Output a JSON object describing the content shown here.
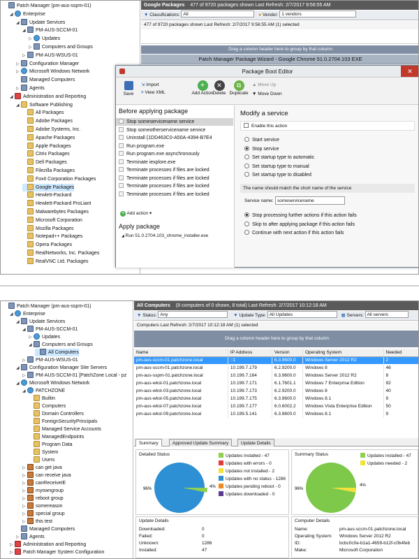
{
  "top": {
    "tree": [
      {
        "label": "Patch Manager (pm-aus-sspm-01)",
        "icon": "server",
        "indent": 0,
        "exp": "",
        "sel": false
      },
      {
        "label": "Enterprise",
        "icon": "globe",
        "indent": 1,
        "exp": "◢",
        "sel": false
      },
      {
        "label": "Update Services",
        "icon": "server",
        "indent": 2,
        "exp": "◢",
        "sel": false
      },
      {
        "label": "PM-AUS-SCCM-01",
        "icon": "server",
        "indent": 3,
        "exp": "◢",
        "sel": false
      },
      {
        "label": "Updates",
        "icon": "globe",
        "indent": 4,
        "exp": "▷",
        "sel": false
      },
      {
        "label": "Computers and Groups",
        "icon": "server",
        "indent": 4,
        "exp": "▷",
        "sel": false
      },
      {
        "label": "PM-AUS-WSUS-01",
        "icon": "server",
        "indent": 3,
        "exp": "▷",
        "sel": false
      },
      {
        "label": "Configuration Manager",
        "icon": "server",
        "indent": 2,
        "exp": "▷",
        "sel": false
      },
      {
        "label": "Microsoft Windows Network",
        "icon": "globe",
        "indent": 2,
        "exp": "▷",
        "sel": false
      },
      {
        "label": "Managed Computers",
        "icon": "server",
        "indent": 2,
        "exp": "",
        "sel": false
      },
      {
        "label": "Agents",
        "icon": "server",
        "indent": 2,
        "exp": "▷",
        "sel": false
      },
      {
        "label": "Administration and Reporting",
        "icon": "gear",
        "indent": 1,
        "exp": "◢",
        "sel": false
      },
      {
        "label": "Software Publishing",
        "icon": "folder",
        "indent": 2,
        "exp": "◢",
        "sel": false
      },
      {
        "label": "All Packages",
        "icon": "folder",
        "indent": 3,
        "exp": "",
        "sel": false
      },
      {
        "label": "Adobe Packages",
        "icon": "folder",
        "indent": 3,
        "exp": "",
        "sel": false
      },
      {
        "label": "Adobe Systems, Inc.",
        "icon": "folder",
        "indent": 3,
        "exp": "",
        "sel": false
      },
      {
        "label": "Apache Packages",
        "icon": "folder",
        "indent": 3,
        "exp": "",
        "sel": false
      },
      {
        "label": "Apple Packages",
        "icon": "folder",
        "indent": 3,
        "exp": "",
        "sel": false
      },
      {
        "label": "Citrix Packages",
        "icon": "folder",
        "indent": 3,
        "exp": "",
        "sel": false
      },
      {
        "label": "Dell Packages",
        "icon": "folder",
        "indent": 3,
        "exp": "",
        "sel": false
      },
      {
        "label": "Filezilla Packages",
        "icon": "folder",
        "indent": 3,
        "exp": "",
        "sel": false
      },
      {
        "label": "Foxit Corporation Packages",
        "icon": "folder",
        "indent": 3,
        "exp": "",
        "sel": false
      },
      {
        "label": "Google Packages",
        "icon": "folder",
        "indent": 3,
        "exp": "",
        "sel": true
      },
      {
        "label": "Hewlett-Packard",
        "icon": "folder",
        "indent": 3,
        "exp": "",
        "sel": false
      },
      {
        "label": "Hewlett-Packard ProLiant",
        "icon": "folder",
        "indent": 3,
        "exp": "",
        "sel": false
      },
      {
        "label": "Malwarebytes Packages",
        "icon": "folder",
        "indent": 3,
        "exp": "",
        "sel": false
      },
      {
        "label": "Microsoft Corporation",
        "icon": "folder",
        "indent": 3,
        "exp": "",
        "sel": false
      },
      {
        "label": "Mozilla Packages",
        "icon": "folder",
        "indent": 3,
        "exp": "",
        "sel": false
      },
      {
        "label": "Notepad++ Packages",
        "icon": "folder",
        "indent": 3,
        "exp": "",
        "sel": false
      },
      {
        "label": "Opera Packages",
        "icon": "folder",
        "indent": 3,
        "exp": "",
        "sel": false
      },
      {
        "label": "RealNetworks, Inc. Packages",
        "icon": "folder",
        "indent": 3,
        "exp": "",
        "sel": false
      },
      {
        "label": "RealVNC Ltd. Packages",
        "icon": "folder",
        "indent": 3,
        "exp": "",
        "sel": false
      }
    ],
    "header_title": "Google Packages",
    "header_status": "477 of 9720 packages shown  Last Refresh: 2/7/2017 9:56:55 AM",
    "header_count": "1 vendors",
    "classifications_label": "Classifications:",
    "classifications_value": "All",
    "vendor_label": "Vendor:",
    "vendor_value": "1 vendors",
    "grid_status": "477 of 9720 packages shown     Last Refresh: 2/7/2017 9:56:55 AM  (1) selected",
    "drag_text": "Drag a column header here to group by that column",
    "wizard_title": "Patch Manager Package Wizard - Google Chrome 51.0.2704.103 EXE",
    "editor": {
      "title": "Package Boot Editor",
      "toolbar": {
        "save": "Save",
        "import": "Import",
        "view_xml": "View XML",
        "add_action": "Add Action",
        "delete": "Delete",
        "duplicate": "Duplicate",
        "move_up": "Move Up",
        "move_down": "Move Down"
      },
      "before_heading": "Before applying package",
      "before_items": [
        "Stop someservicename service",
        "Stop someotherservicename service",
        "Uninstall {1DD463C0-A50A-4394-B7E4",
        "Run program.exe",
        "Run program.exe asynchronously",
        "Terminate iexplore.exe",
        "Terminate processes if files are locked",
        "Terminate processes if files are locked",
        "Terminate processes if files are locked",
        "Terminate processes if files are locked"
      ],
      "add_action_link": "Add action",
      "apply_heading": "Apply package",
      "apply_item": "Run 51.0.2704.103_chrome_installer.exe",
      "modify_heading": "Modify a service",
      "enable_label": "Enable this action",
      "service_options": [
        "Start service",
        "Stop service",
        "Set startup type to automatic",
        "Set startup type to manual",
        "Set startup type to disabled"
      ],
      "service_selected": 1,
      "hint": "The name should match the short name of the service",
      "service_name_label": "Service name:",
      "service_name_value": "someservicename",
      "failure_options": [
        "Stop processing further actions if this action fails",
        "Skip to after applying package if this action fails",
        "Continue with next action if this action fails"
      ],
      "failure_selected": 0
    }
  },
  "bottom": {
    "tree": [
      {
        "label": "Patch Manager (pm-aus-sspm-01)",
        "icon": "server",
        "indent": 0,
        "exp": "",
        "sel": false
      },
      {
        "label": "Enterprise",
        "icon": "globe",
        "indent": 1,
        "exp": "◢",
        "sel": false
      },
      {
        "label": "Update Services",
        "icon": "server",
        "indent": 2,
        "exp": "◢",
        "sel": false
      },
      {
        "label": "PM-AUS-SCCM-01",
        "icon": "server",
        "indent": 3,
        "exp": "◢",
        "sel": false
      },
      {
        "label": "Updates",
        "icon": "globe",
        "indent": 4,
        "exp": "▷",
        "sel": false
      },
      {
        "label": "Computers and Groups",
        "icon": "server",
        "indent": 4,
        "exp": "◢",
        "sel": false
      },
      {
        "label": "All Computers",
        "icon": "server",
        "indent": 5,
        "exp": "",
        "sel": true
      },
      {
        "label": "PM-AUS-WSUS-01",
        "icon": "server",
        "indent": 3,
        "exp": "▷",
        "sel": false
      },
      {
        "label": "Configuration Manager Site Servers",
        "icon": "server",
        "indent": 2,
        "exp": "◢",
        "sel": false
      },
      {
        "label": "PM-AUS-SCCM-01 [PatchZone Local - pz",
        "icon": "server",
        "indent": 3,
        "exp": "▷",
        "sel": false
      },
      {
        "label": "Microsoft Windows Network",
        "icon": "globe",
        "indent": 2,
        "exp": "◢",
        "sel": false
      },
      {
        "label": "PATCHZONE",
        "icon": "globe",
        "indent": 3,
        "exp": "◢",
        "sel": false
      },
      {
        "label": "Builtin",
        "icon": "folder",
        "indent": 4,
        "exp": "",
        "sel": false
      },
      {
        "label": "Computers",
        "icon": "folder",
        "indent": 4,
        "exp": "",
        "sel": false
      },
      {
        "label": "Domain Controllers",
        "icon": "folder",
        "indent": 4,
        "exp": "",
        "sel": false
      },
      {
        "label": "ForeignSecurityPrincipals",
        "icon": "folder",
        "indent": 4,
        "exp": "",
        "sel": false
      },
      {
        "label": "Managed Service Accounts",
        "icon": "folder",
        "indent": 4,
        "exp": "",
        "sel": false
      },
      {
        "label": "ManagedEndpoints",
        "icon": "folder",
        "indent": 4,
        "exp": "",
        "sel": false
      },
      {
        "label": "Program Data",
        "icon": "folder",
        "indent": 4,
        "exp": "",
        "sel": false
      },
      {
        "label": "System",
        "icon": "folder",
        "indent": 4,
        "exp": "",
        "sel": false
      },
      {
        "label": "Users",
        "icon": "folder",
        "indent": 4,
        "exp": "",
        "sel": false
      },
      {
        "label": "can get java",
        "icon": "pkg",
        "indent": 3,
        "exp": "▷",
        "sel": false
      },
      {
        "label": "can receive java",
        "icon": "pkg",
        "indent": 3,
        "exp": "▷",
        "sel": false
      },
      {
        "label": "canReceiveIE",
        "icon": "pkg",
        "indent": 3,
        "exp": "▷",
        "sel": false
      },
      {
        "label": "myowngroup",
        "icon": "pkg",
        "indent": 3,
        "exp": "▷",
        "sel": false
      },
      {
        "label": "reboot group",
        "icon": "pkg",
        "indent": 3,
        "exp": "▷",
        "sel": false
      },
      {
        "label": "somereason",
        "icon": "pkg",
        "indent": 3,
        "exp": "▷",
        "sel": false
      },
      {
        "label": "special group",
        "icon": "pkg",
        "indent": 3,
        "exp": "▷",
        "sel": false
      },
      {
        "label": "this test",
        "icon": "pkg",
        "indent": 3,
        "exp": "▷",
        "sel": false
      },
      {
        "label": "Managed Computers",
        "icon": "server",
        "indent": 2,
        "exp": "",
        "sel": false
      },
      {
        "label": "Agents",
        "icon": "server",
        "indent": 2,
        "exp": "▷",
        "sel": false
      },
      {
        "label": "Administration and Reporting",
        "icon": "gear",
        "indent": 1,
        "exp": "▷",
        "sel": false
      },
      {
        "label": "Patch Manager System Configuration",
        "icon": "gear",
        "indent": 1,
        "exp": "▷",
        "sel": false
      }
    ],
    "header_title": "All Computers",
    "header_status": "(8 computers of 0 shown, 8 total) Last Refresh: 2/7/2017 10:12:18 AM",
    "status_label": "Status:",
    "status_value": "Any",
    "update_type_label": "Update Type:",
    "update_type_value": "All Updates",
    "servers_label": "Servers:",
    "servers_value": "All servers",
    "grid_status": "Computers Last Refresh: 2/7/2017 10:12:18 AM  (1) selected",
    "drag_text": "Drag a column header here to group by that column",
    "columns": [
      "Name",
      "IP Address",
      "Version",
      "Operating System",
      "Needed"
    ],
    "rows": [
      [
        "pm-aus-sccm-01.patchzone.local",
        "::1",
        "6.3.9600.0",
        "Windows Server 2012 R2",
        "2"
      ],
      [
        "pm-aus-sccm-01.patchzone.local",
        "10.199.7.179",
        "6.2.9200.0",
        "Windows 8",
        "46"
      ],
      [
        "pm-aus-sspm-01.patchzone.local",
        "10.199.7.164",
        "6.3.9600.0",
        "Windows Server 2012 R2",
        "8"
      ],
      [
        "pm-aus-wkst-01.patchzone.local",
        "10.199.7.171",
        "6.1.7601.1",
        "Windows 7 Enterprise Edition",
        "92"
      ],
      [
        "pm-aus-wkst-03.patchzone.local",
        "10.199.7.173",
        "6.2.9200.0",
        "Windows 8",
        "40"
      ],
      [
        "pm-aus-wkst-05.patchzone.local",
        "10.199.7.175",
        "6.3.9600.0",
        "Windows 8.1",
        "9"
      ],
      [
        "pm-aus-wkst-07.patchzone.local",
        "10.199.7.177",
        "6.0.6002.2",
        "Windows Vista Enterprise Edition",
        "50"
      ],
      [
        "pm-aus-wkst-09.patchzone.local",
        "10.199.5.141",
        "6.3.9600.0",
        "Windows 8.1",
        "9"
      ]
    ],
    "selected_row": 0,
    "tabs": [
      "Summary",
      "Approved Update Summary",
      "Update Details"
    ],
    "detailed_status_title": "Detailed Status",
    "detailed_legend": [
      {
        "label": "Updates installed - 47",
        "color": "#8fd14f"
      },
      {
        "label": "Updates with errors - 0",
        "color": "#e23b3b"
      },
      {
        "label": "Updates not installed - 2",
        "color": "#f2e23a"
      },
      {
        "label": "Updates with no status - 1286",
        "color": "#2d8fd4"
      },
      {
        "label": "Updates pending reboot - 0",
        "color": "#f08a24"
      },
      {
        "label": "Updates downloaded - 0",
        "color": "#5a3b8f"
      }
    ],
    "detailed_pie_labels": [
      "96%",
      "4%"
    ],
    "summary_status_title": "Summary Status",
    "summary_legend": [
      {
        "label": "Updates installed - 47",
        "color": "#8fd14f"
      },
      {
        "label": "Updates needed - 2",
        "color": "#f2e23a"
      }
    ],
    "summary_pie_labels": [
      "96%",
      "4%"
    ],
    "update_details_title": "Update Details",
    "update_details": [
      {
        "k": "Downloaded:",
        "v": "0"
      },
      {
        "k": "Failed:",
        "v": "0"
      },
      {
        "k": "Unknown:",
        "v": "1286"
      },
      {
        "k": "Installed:",
        "v": "47"
      }
    ],
    "computer_details_title": "Computer Details",
    "computer_details": [
      {
        "k": "Name:",
        "v": "pm-aus-sccm-01.patchzone.local"
      },
      {
        "k": "Operating System:",
        "v": "Windows Server 2012 R2"
      },
      {
        "k": "ID:",
        "v": "bcbc0c0e-b1a1-4659-b12f-c0b4feb"
      },
      {
        "k": "Make:",
        "v": "Microsoft Corporation"
      }
    ]
  }
}
